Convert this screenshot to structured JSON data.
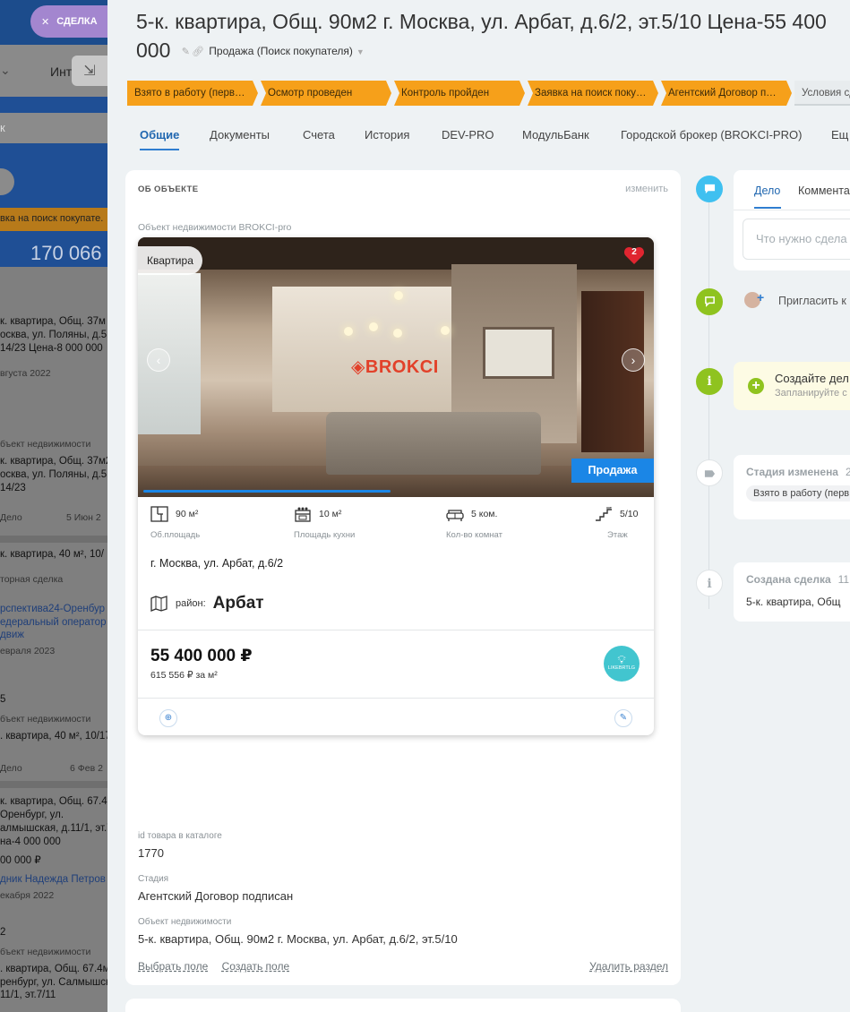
{
  "left_panel": {
    "top_button": "СДЕЛКА",
    "int_label": "Инт",
    "search_text": "к",
    "stage_text": "вка на поиск покупате.",
    "sum": "170 066 ₽",
    "cards": [
      {
        "lines": [
          "к. квартира, Общ. 37м",
          "осква, ул. Поляны, д.5",
          "14/23 Цена-8 000 000"
        ],
        "date": "вгуста 2022"
      },
      {
        "label": "бъект недвижимости",
        "lines": [
          "к. квартира, Общ. 37м2",
          "осква, ул. Поляны, д.5,",
          "14/23"
        ],
        "foot_left": "Дело",
        "foot_right": "5 Июн 2"
      },
      {
        "lines": [
          "к. квартира, 40 м², 10/"
        ],
        "label": "торная сделка",
        "links": [
          "рспектива24-Оренбур",
          "едеральный оператор",
          "движ"
        ],
        "date": "евраля 2023"
      },
      {
        "num": "5",
        "label": "бъект недвижимости",
        "lines": [
          ". квартира, 40 м², 10/17"
        ],
        "foot_left": "Дело",
        "foot_right": "6 Фев 2"
      },
      {
        "lines": [
          "к. квартира, Общ. 67.4",
          "Оренбург, ул.",
          "алмышская, д.11/1, эт.7",
          "на-4 000 000"
        ],
        "price": "00 000 ₽",
        "link": "дник Надежда Петров",
        "date": "екабря 2022"
      },
      {
        "num": "2",
        "label": "бъект недвижимости",
        "lines": [
          ". квартира, Общ. 67.4м",
          "ренбург, ул. Салмышска",
          "11/1, эт.7/11"
        ]
      }
    ]
  },
  "header": {
    "title": "5-к. квартира, Общ. 90м2 г. Москва, ул. Арбат, д.6/2, эт.5/10 Цена-55 400 000",
    "pipeline": "Продажа (Поиск покупателя)"
  },
  "stages": [
    "Взято в работу (перв…",
    "Осмотр проведен",
    "Контроль пройден",
    "Заявка на поиск поку…",
    "Агентский Договор п…",
    "Условия сд"
  ],
  "tabs": [
    "Общие",
    "Документы",
    "Счета",
    "История",
    "DEV-PRO",
    "МодульБанк",
    "Городской брокер (BROKCI-PRO)",
    "Ещ"
  ],
  "section": {
    "title": "ОБ ОБЪЕКТЕ",
    "edit": "изменить",
    "object_label": "Объект недвижимости BROKCI-pro"
  },
  "product": {
    "type_badge": "Квартира",
    "fav_count": "2",
    "logo_text": "BROKCI",
    "sale_badge": "Продажа",
    "photo_progress": 0.49,
    "specs": [
      {
        "icon": "floorplan-icon",
        "value": "90 м²",
        "caption": "Об.площадь"
      },
      {
        "icon": "stove-icon",
        "value": "10 м²",
        "caption": "Площадь кухни"
      },
      {
        "icon": "sofa-icon",
        "value": "5 ком.",
        "caption": "Кол-во комнат"
      },
      {
        "icon": "stairs-icon",
        "value": "5/10",
        "caption": "Этаж"
      }
    ],
    "address": "г. Москва, ул. Арбат, д.6/2",
    "district_label": "район:",
    "district": "Арбат",
    "price": "55 400 000 ₽",
    "price_per_m2": "615 556 ₽ за м²",
    "brand_circle_text": "LIKEBRTLG"
  },
  "fields": [
    {
      "label": "id товара в каталоге",
      "value": "1770"
    },
    {
      "label": "Стадия",
      "value": "Агентский Договор подписан"
    },
    {
      "label": "Объект недвижимости",
      "value": "5-к. квартира, Общ. 90м2 г. Москва, ул. Арбат, д.6/2, эт.5/10"
    }
  ],
  "links": {
    "select_field": "Выбрать поле",
    "create_field": "Создать поле",
    "delete_section": "Удалить раздел"
  },
  "timeline": {
    "tabs": [
      "Дело",
      "Коммента"
    ],
    "input_placeholder": "Что нужно сдела",
    "invite": "Пригласить к",
    "create_title": "Создайте дел",
    "create_sub": "Запланируйте с",
    "stage_changed": "Стадия изменена",
    "stage_changed_mark": "2",
    "stage_chip": "Взято в работу (перв",
    "deal_created": "Создана сделка",
    "deal_created_mark": "11",
    "deal_created_text": "5-к. квартира, Общ"
  },
  "colors": {
    "stage_orange": "#f6a01a",
    "tab_active": "#2067b0",
    "sale_badge": "#1b86e6",
    "heart": "#e02530",
    "tl_blue": "#3fc0f0",
    "tl_green": "#8fc31f"
  }
}
